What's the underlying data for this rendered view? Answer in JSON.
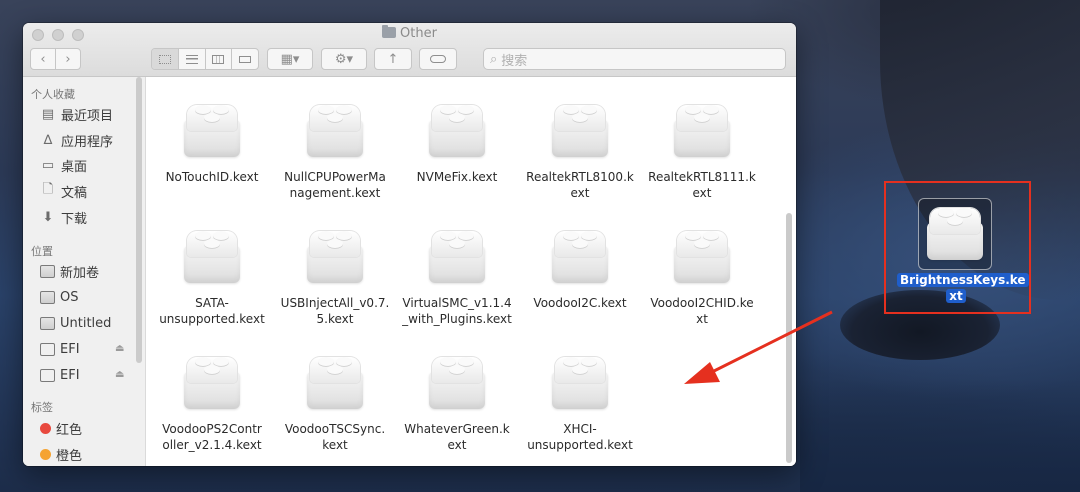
{
  "window": {
    "title": "Other",
    "search_placeholder": "搜索"
  },
  "sidebar": {
    "sections": [
      {
        "header": "个人收藏",
        "items": [
          {
            "label": "最近项目",
            "icon": "recents-icon"
          },
          {
            "label": "应用程序",
            "icon": "applications-icon"
          },
          {
            "label": "桌面",
            "icon": "desktop-icon"
          },
          {
            "label": "文稿",
            "icon": "documents-icon"
          },
          {
            "label": "下载",
            "icon": "downloads-icon"
          }
        ]
      },
      {
        "header": "位置",
        "items": [
          {
            "label": "新加卷",
            "icon": "disk-icon"
          },
          {
            "label": "OS",
            "icon": "disk-icon"
          },
          {
            "label": "Untitled",
            "icon": "disk-icon"
          },
          {
            "label": "EFI",
            "icon": "external-disk-icon"
          },
          {
            "label": "EFI",
            "icon": "external-disk-icon"
          }
        ]
      },
      {
        "header": "标签",
        "items": [
          {
            "label": "红色",
            "color": "#e8493e"
          },
          {
            "label": "橙色",
            "color": "#f5a331"
          }
        ]
      }
    ]
  },
  "files": [
    [
      "NoTouchID.kext"
    ],
    [
      "NullCPUPowerMa",
      "nagement.kext"
    ],
    [
      "NVMeFix.kext"
    ],
    [
      "RealtekRTL8100.k",
      "ext"
    ],
    [
      "RealtekRTL8111.k",
      "ext"
    ],
    [
      "SATA-",
      "unsupported.kext"
    ],
    [
      "USBInjectAll_v0.7.",
      "5.kext"
    ],
    [
      "VirtualSMC_v1.1.4",
      "_with_Plugins.kext"
    ],
    [
      "VoodooI2C.kext"
    ],
    [
      "VoodooI2CHID.ke",
      "xt"
    ],
    [
      "VoodooPS2Contr",
      "oller_v2.1.4.kext"
    ],
    [
      "VoodooTSCSync.",
      "kext"
    ],
    [
      "WhateverGreen.k",
      "ext"
    ],
    [
      "XHCI-",
      "unsupported.kext"
    ]
  ],
  "desktop_item": {
    "label_line1": "BrightnessKeys.ke",
    "label_line2": "xt",
    "highlight_color": "#e5301f"
  }
}
